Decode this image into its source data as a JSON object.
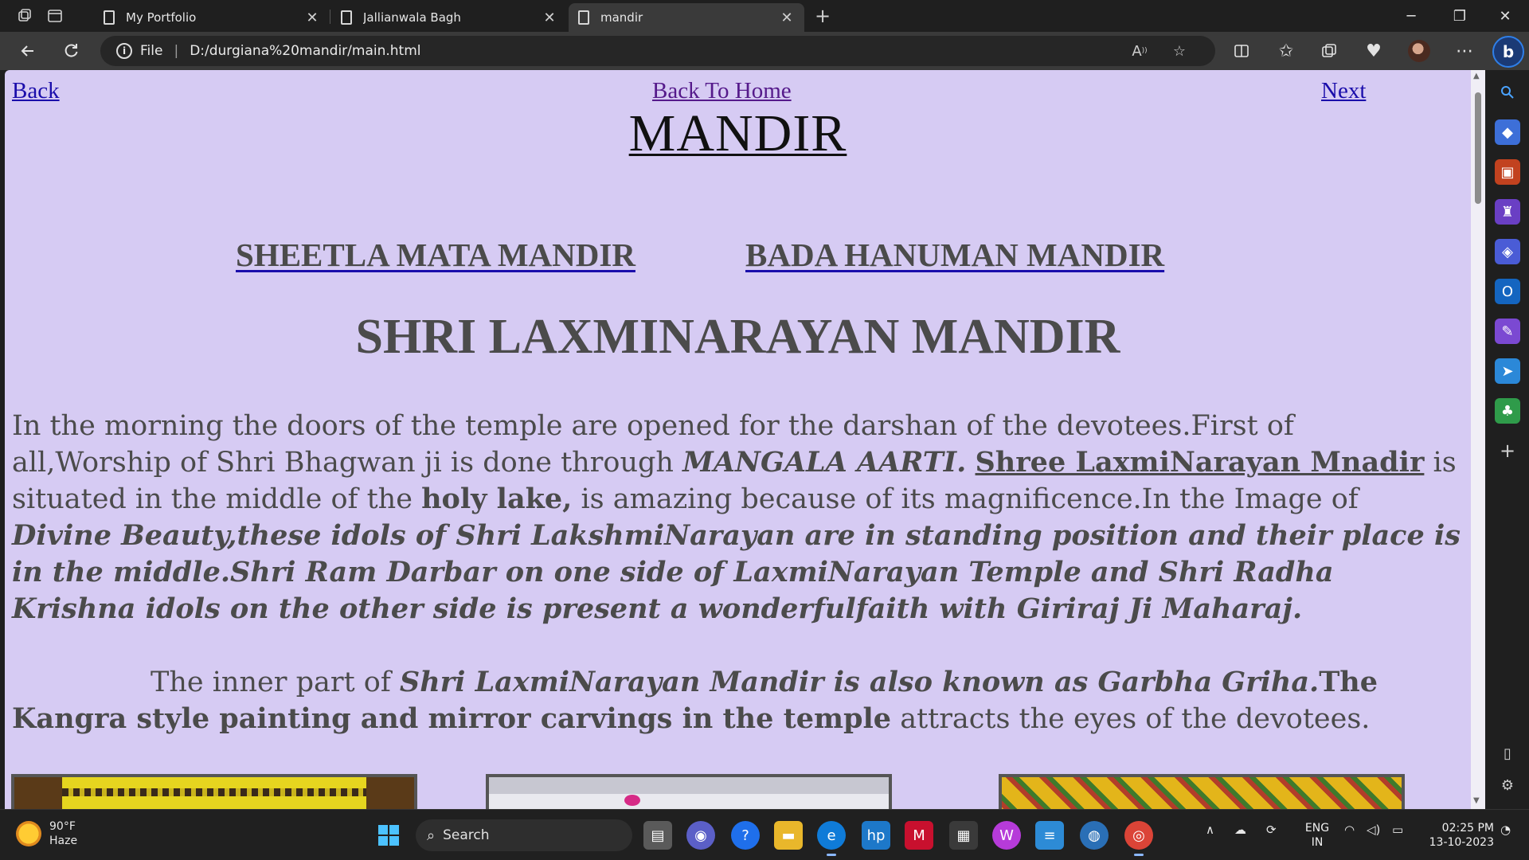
{
  "browser": {
    "tabs": [
      {
        "title": "My Portfolio",
        "active": false
      },
      {
        "title": "Jallianwala Bagh",
        "active": false
      },
      {
        "title": "mandir",
        "active": true
      }
    ],
    "new_tab_label": "+",
    "window_controls": {
      "minimize": "─",
      "maximize": "❐",
      "close": "✕"
    },
    "address": {
      "info_icon": "i",
      "scheme": "File",
      "url": "D:/durgiana%20mandir/main.html"
    },
    "toolbar_icons": [
      "read-aloud-icon",
      "favorite-star-icon",
      "split-screen-icon",
      "favorites-icon",
      "collections-icon",
      "browser-essentials-icon",
      "profile-avatar",
      "more-menu-icon",
      "bing-copilot-icon"
    ],
    "bing_label": "b"
  },
  "page": {
    "nav": {
      "back": "Back",
      "home": "Back To Home",
      "next": "Next"
    },
    "title": "MANDIR",
    "sub_links": [
      "SHEETLA MATA MANDIR",
      "BADA HANUMAN MANDIR"
    ],
    "heading": "SHRI LAXMINARAYAN MANDIR",
    "para1": {
      "t1": "In the morning the doors of the temple are opened for the darshan of the devotees.First of all,Worship of Shri Bhagwan ji is done through ",
      "t2": "MANGALA AARTI.",
      "t3": " ",
      "t4": "Shree LaxmiNarayan Mnadir",
      "t5": " is situated in the middle of the ",
      "t6": "holy lake,",
      "t7": " is amazing because of its magnificence.In the Image of ",
      "t8": "Divine Beauty,these idols of Shri LakshmiNarayan are in standing position and their place is in the middle.Shri Ram Darbar on one side of LaxmiNarayan Temple and Shri Radha Krishna idols on the other side is present a wonderfulfaith with Giriraj Ji Maharaj."
    },
    "para2": {
      "t1": "The inner part of ",
      "t2": "Shri LaxmiNarayan Mandir is also known as Garbha Griha.",
      "t3": "The Kangra style painting and mirror carvings in the temple",
      "t4": " attracts the eyes of the devotees."
    }
  },
  "taskbar": {
    "weather": {
      "temp": "90°F",
      "condition": "Haze"
    },
    "search_label": "Search",
    "lang": {
      "line1": "ENG",
      "line2": "IN"
    },
    "clock": {
      "time": "02:25 PM",
      "date": "13-10-2023"
    }
  }
}
